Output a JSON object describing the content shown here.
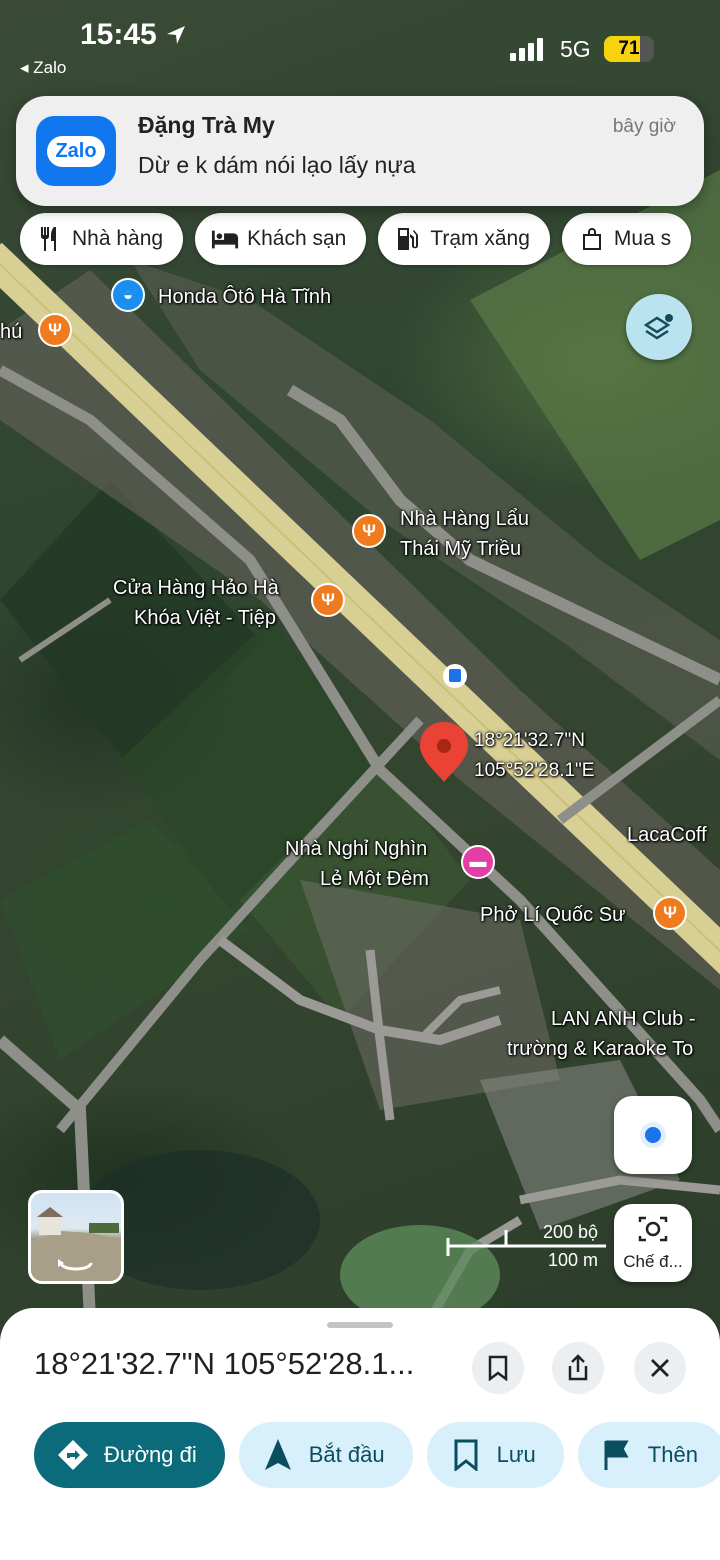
{
  "status_bar": {
    "time": "15:45",
    "back_app": "◂ Zalo",
    "network": "5G",
    "battery": "71",
    "battery_level": 0.71
  },
  "notification": {
    "app": "Zalo",
    "sender": "Đặng Trà My",
    "message": "Dừ e k dám nói lạo lấy nựa",
    "time": "bây giờ"
  },
  "chips": [
    {
      "label": "Nhà hàng",
      "icon": "restaurant-icon"
    },
    {
      "label": "Khách sạn",
      "icon": "hotel-icon"
    },
    {
      "label": "Trạm xăng",
      "icon": "gas-station-icon"
    },
    {
      "label": "Mua s",
      "icon": "shopping-bag-icon"
    }
  ],
  "map": {
    "places": {
      "honda": "Honda Ôtô Hà Tĩnh",
      "phu": "hú",
      "nha_hang_lau_1": "Nhà Hàng Lẩu",
      "nha_hang_lau_2": "Thái Mỹ Triều",
      "cua_hang_1": "Cửa Hàng Hảo Hà",
      "cua_hang_2": "Khóa Việt - Tiệp",
      "coord_lat": "18°21'32.7\"N",
      "coord_lon": "105°52'28.1\"E",
      "nha_nghi_1": "Nhà Nghỉ Nghìn",
      "nha_nghi_2": "Lẻ Một Đêm",
      "laca": "LacaCoff",
      "pho": "Phở Lí Quốc Sư",
      "lan_anh_1": "LAN ANH Club -",
      "lan_anh_2": "trường & Karaoke To"
    },
    "scale_feet": "200 bộ",
    "scale_meters": "100 m",
    "lens_label": "Chế đ..."
  },
  "sheet": {
    "title": "18°21'32.7\"N 105°52'28.1...",
    "actions": [
      {
        "label": "Đường đi",
        "icon": "directions-icon"
      },
      {
        "label": "Bắt đầu",
        "icon": "navigation-arrow-icon"
      },
      {
        "label": "Lưu",
        "icon": "bookmark-icon"
      },
      {
        "label": "Thên",
        "icon": "flag-icon"
      }
    ]
  }
}
